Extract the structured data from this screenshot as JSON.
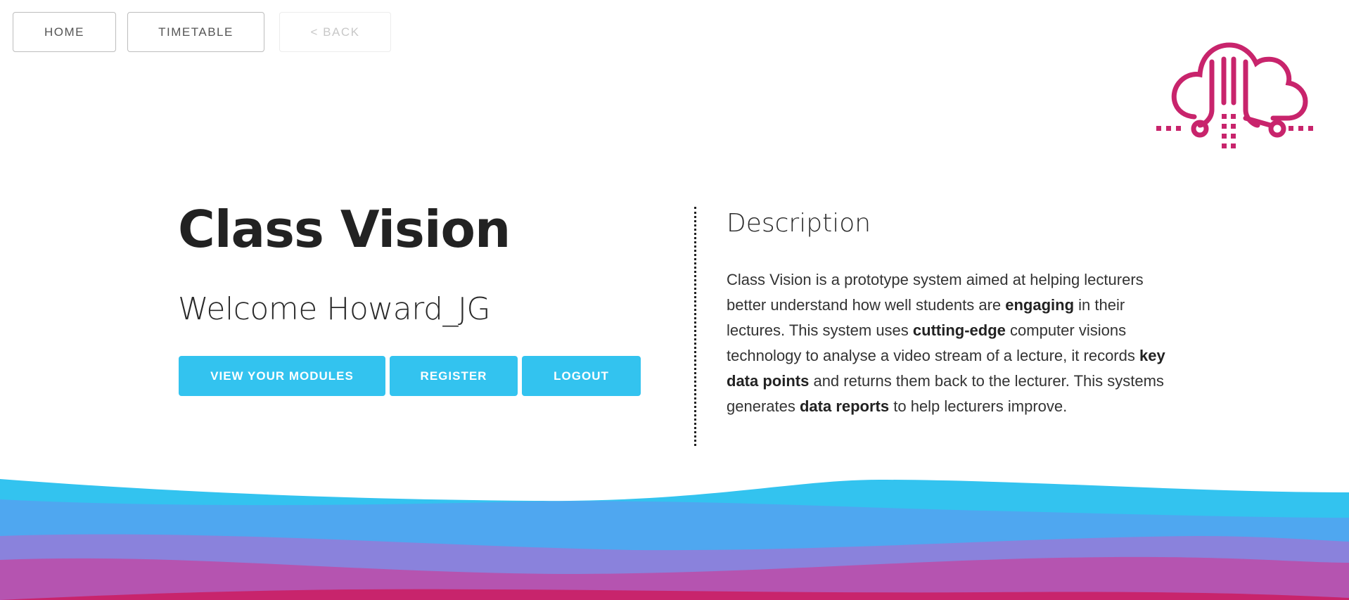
{
  "nav": {
    "home_label": "HOME",
    "timetable_label": "TIMETABLE",
    "back_label": "< BACK"
  },
  "logo": {
    "icon": "class-vision-cloud-logo",
    "color": "#c8246c"
  },
  "hero": {
    "title": "Class Vision",
    "welcome": "Welcome Howard_JG"
  },
  "actions": {
    "modules_label": "VIEW YOUR MODULES",
    "register_label": "REGISTER",
    "logout_label": "LOGOUT",
    "color": "#33c3ef"
  },
  "description": {
    "heading": "Description",
    "p1": "Class Vision is a prototype system aimed at helping lecturers better understand how well students are ",
    "b1": "engaging",
    "p2": " in their lectures. This system uses ",
    "b2": "cutting-edge",
    "p3": " computer visions technology to analyse a video stream of a lecture, it records ",
    "b3": "key data points",
    "p4": " and returns them back to the lecturer. This systems generates ",
    "b4": "data reports",
    "p5": " to help lecturers improve."
  },
  "waves": {
    "colors": [
      "#33c3ef",
      "#4fa7f0",
      "#8a82dc",
      "#b554b0",
      "#c8246c"
    ]
  }
}
